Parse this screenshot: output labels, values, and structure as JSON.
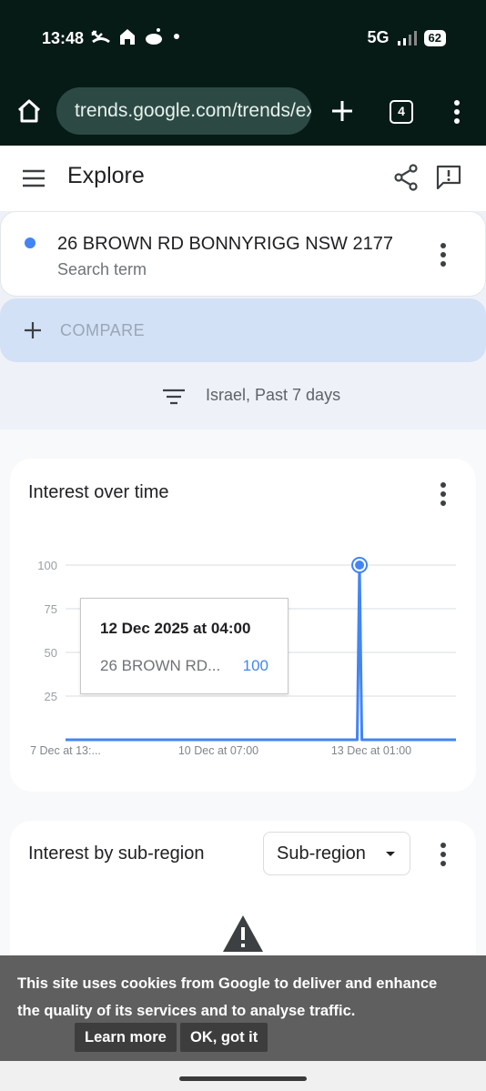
{
  "status_bar": {
    "time": "13:48",
    "network": "5G",
    "battery": "62"
  },
  "browser": {
    "url": "trends.google.com/trends/explore",
    "tab_count": "4"
  },
  "header": {
    "title": "Explore"
  },
  "search_term": {
    "name": "26 BROWN RD BONNYRIGG NSW 2177",
    "type": "Search term",
    "color": "#4285f4"
  },
  "compare": {
    "label": "COMPARE"
  },
  "filter": {
    "label": "Israel, Past 7 days"
  },
  "interest_over_time": {
    "title": "Interest over time",
    "tooltip": {
      "date": "12 Dec 2025 at 04:00",
      "term": "26 BROWN RD...",
      "value": "100"
    },
    "chart_data": {
      "type": "line",
      "x_tick_labels": [
        "7 Dec at 13:...",
        "10 Dec at 07:00",
        "13 Dec at 01:00"
      ],
      "y_tick_labels": [
        "100",
        "75",
        "50",
        "25"
      ],
      "ylim": [
        0,
        100
      ],
      "grid": true,
      "series": [
        {
          "name": "26 BROWN RD BONNYRIGG NSW 2177",
          "color": "#4285f4",
          "values": [
            0,
            0,
            0,
            0,
            0,
            0,
            0,
            0,
            0,
            0,
            0,
            0,
            0,
            0,
            0,
            0,
            0,
            0,
            0,
            0,
            0,
            0,
            0,
            0,
            0,
            0,
            0,
            0,
            0,
            0,
            0,
            0,
            0,
            0,
            0,
            0,
            0,
            0,
            0,
            0,
            0,
            0,
            0,
            0,
            0,
            0,
            0,
            0,
            0,
            0,
            0,
            0,
            0,
            0,
            0,
            0,
            0,
            0,
            0,
            0,
            0,
            0,
            0,
            0,
            0,
            0,
            0,
            0,
            0,
            0,
            0,
            0,
            0,
            0,
            0,
            0,
            0,
            0,
            0,
            0,
            0,
            0,
            0,
            0,
            0,
            0,
            0,
            0,
            0,
            0,
            0,
            0,
            0,
            0,
            0,
            0,
            0,
            0,
            0,
            0,
            0,
            0,
            0,
            0,
            0,
            0,
            0,
            0,
            0,
            0,
            0,
            0,
            0,
            0,
            0,
            0,
            0,
            0,
            0,
            0,
            0,
            0,
            0,
            0,
            0,
            100,
            0,
            0,
            0,
            0,
            0,
            0,
            0,
            0,
            0,
            0,
            0,
            0,
            0,
            0,
            0,
            0,
            0,
            0,
            0,
            0,
            0,
            0,
            0,
            0,
            0,
            0,
            0,
            0,
            0,
            0,
            0,
            0,
            0,
            0,
            0,
            0,
            0,
            0,
            0,
            0,
            0
          ],
          "highlight_index": 125
        }
      ]
    }
  },
  "sub_region": {
    "title": "Interest by sub-region",
    "select_value": "Sub-region"
  },
  "cookie_banner": {
    "text": "This site uses cookies from Google to deliver and enhance the quality of its services and to analyse traffic.",
    "learn_more": "Learn more",
    "ok": "OK, got it"
  }
}
